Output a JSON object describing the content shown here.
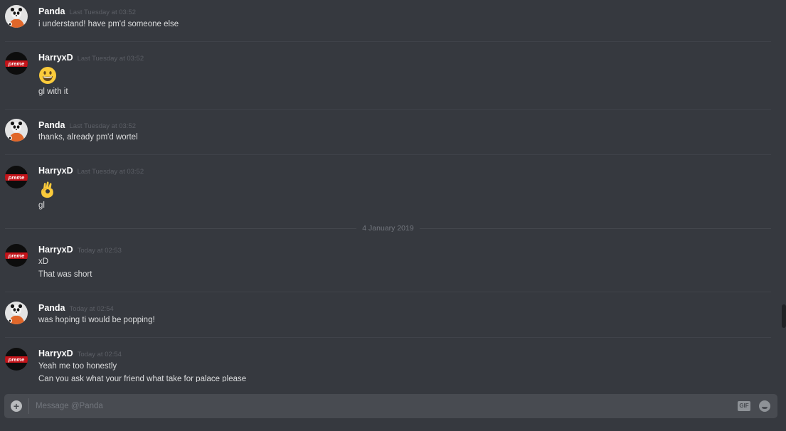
{
  "messages": [
    {
      "author": "Panda",
      "timestamp": "Last Tuesday at 03:52",
      "lines": [
        "i understand! have pm'd someone else"
      ]
    },
    {
      "author": "HarryxD",
      "timestamp": "Last Tuesday at 03:52",
      "emoji": "smiley-face",
      "lines": [
        "gl with it"
      ]
    },
    {
      "author": "Panda",
      "timestamp": "Last Tuesday at 03:52",
      "lines": [
        "thanks, already pm'd wortel"
      ]
    },
    {
      "author": "HarryxD",
      "timestamp": "Last Tuesday at 03:52",
      "emoji": "ok-hand",
      "lines": [
        "gl"
      ]
    },
    {
      "author": "HarryxD",
      "timestamp": "Today at 02:53",
      "lines": [
        "xD",
        "That was short"
      ]
    },
    {
      "author": "Panda",
      "timestamp": "Today at 02:54",
      "lines": [
        "was hoping ti would be popping!"
      ]
    },
    {
      "author": "HarryxD",
      "timestamp": "Today at 02:54",
      "lines": [
        "Yeah me too honestly",
        "Can you ask what your friend what take for palace please"
      ]
    }
  ],
  "date_divider": "4 January 2019",
  "composer": {
    "placeholder": "Message @Panda",
    "gif_label": "GIF"
  },
  "colors": {
    "background": "#36393f",
    "input": "#484b51",
    "username": "#ffffff",
    "timestamp": "#5c5f66"
  }
}
